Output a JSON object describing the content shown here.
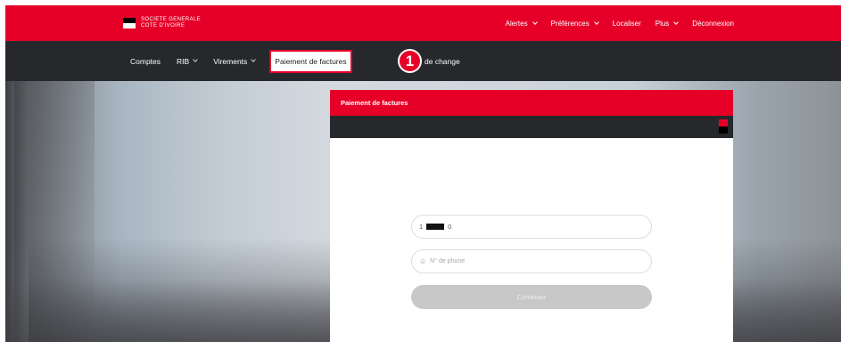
{
  "brand": {
    "line1": "SOCIETE GENERALE",
    "line2": "COTE D'IVOIRE"
  },
  "top_nav": [
    {
      "label": "Alertes",
      "has_dropdown": true
    },
    {
      "label": "Préférences",
      "has_dropdown": true
    },
    {
      "label": "Localiser",
      "has_dropdown": false
    },
    {
      "label": "Plus",
      "has_dropdown": true
    },
    {
      "label": "Déconnexion",
      "has_dropdown": false
    }
  ],
  "sub_nav": [
    {
      "label": "Comptes",
      "has_dropdown": false
    },
    {
      "label": "RIB",
      "has_dropdown": true
    },
    {
      "label": "Virements",
      "has_dropdown": true
    },
    {
      "label": "Paiement de factures",
      "has_dropdown": false,
      "active": true
    }
  ],
  "sub_nav_extra": "de change",
  "step_badge": "1",
  "card": {
    "title": "Paiement de factures",
    "field_account": {
      "prefix": "1",
      "suffix": "0"
    },
    "field_phone": {
      "placeholder": "N° de phone"
    },
    "button_label": "Continuer"
  },
  "colors": {
    "brand_red": "#e60028",
    "dark_bar": "#26282c"
  }
}
